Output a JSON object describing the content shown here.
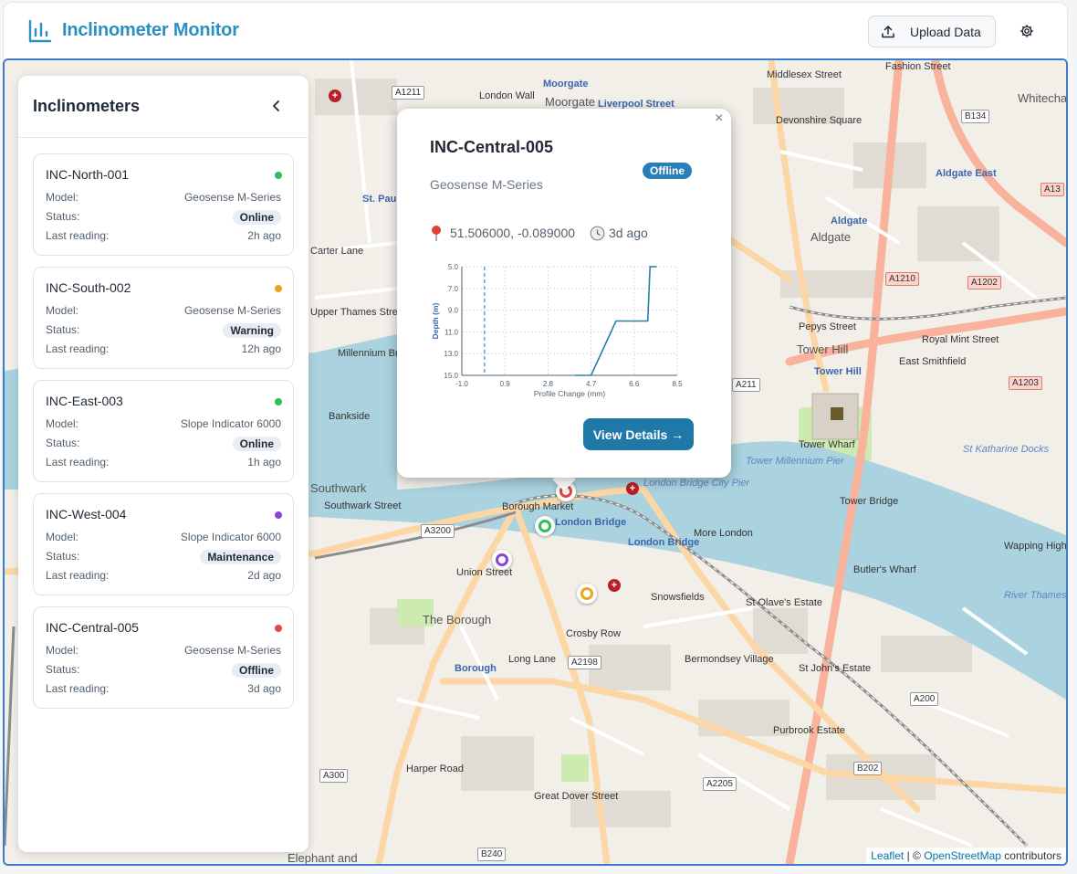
{
  "header": {
    "title": "Inclinometer Monitor",
    "upload_label": "Upload Data",
    "brand_color": "#2b8fc0"
  },
  "sidebar": {
    "title": "Inclinometers",
    "labels": {
      "model": "Model:",
      "status": "Status:",
      "last_reading": "Last reading:"
    },
    "items": [
      {
        "name": "INC-North-001",
        "model": "Geosense M-Series",
        "status": "Online",
        "last_reading": "2h ago",
        "dot_color": "#2ebd59"
      },
      {
        "name": "INC-South-002",
        "model": "Geosense M-Series",
        "status": "Warning",
        "last_reading": "12h ago",
        "dot_color": "#f0a020"
      },
      {
        "name": "INC-East-003",
        "model": "Slope Indicator 6000",
        "status": "Online",
        "last_reading": "1h ago",
        "dot_color": "#2ebd59"
      },
      {
        "name": "INC-West-004",
        "model": "Slope Indicator 6000",
        "status": "Maintenance",
        "last_reading": "2d ago",
        "dot_color": "#8a44d6"
      },
      {
        "name": "INC-Central-005",
        "model": "Geosense M-Series",
        "status": "Offline",
        "last_reading": "3d ago",
        "dot_color": "#e64545"
      }
    ]
  },
  "popup": {
    "title": "INC-Central-005",
    "status": "Offline",
    "model": "Geosense M-Series",
    "coords": "51.506000, -0.089000",
    "age": "3d ago",
    "button": "View Details →",
    "close": "×"
  },
  "chart_data": {
    "type": "line",
    "xlabel": "Profile Change (mm)",
    "ylabel": "Depth (m)",
    "x_ticks": [
      "-1.0",
      "0.9",
      "2.8",
      "4.7",
      "6.6",
      "8.5"
    ],
    "y_ticks": [
      "5.0",
      "7.0",
      "9.0",
      "11.0",
      "13.0",
      "15.0"
    ],
    "xlim": [
      -1.0,
      8.5
    ],
    "ylim": [
      5.0,
      15.0
    ],
    "y_inverted": true,
    "grid": true,
    "reference_x": 0,
    "series": [
      {
        "x": [
          4.0,
          4.7,
          5.8,
          7.2,
          7.3,
          7.6
        ],
        "y": [
          15.0,
          15.0,
          10.0,
          10.0,
          5.0,
          5.0
        ]
      }
    ]
  },
  "map": {
    "labels": [
      "Moorgate",
      "Moorgate",
      "Liverpool Street",
      "London Wall",
      "Middlesex Street",
      "Devonshire Square",
      "Whitechapel",
      "Aldgate East",
      "Aldgate",
      "Aldgate",
      "St. Paul's",
      "Carter Lane",
      "Upper Thames Street",
      "Millennium Bridge",
      "Bankside",
      "Southwark",
      "Southwark Street",
      "Borough Market",
      "London Bridge",
      "London Bridge",
      "London Bridge City Pier",
      "The Borough",
      "Borough",
      "Long Lane",
      "Bermondsey Village",
      "St Olave's Estate",
      "St John's Estate",
      "Tower Hill",
      "Tower Hill",
      "Tower Wharf",
      "Tower Millennium Pier",
      "Tower Bridge",
      "St Katharine Docks",
      "East Smithfield",
      "Royal Mint Street",
      "Pepys Street",
      "Butler's Wharf",
      "River Thames",
      "More London",
      "Purbrook Estate",
      "Great Dover Street",
      "Harper Road",
      "Elephant and",
      "Crosby Row",
      "Snowsfields",
      "Union Street",
      "Fashion Street",
      "Wapping High Street"
    ],
    "roads": [
      "A1211",
      "A1210",
      "A1202",
      "A1203",
      "A13",
      "B134",
      "A3200",
      "A2198",
      "A2205",
      "A200",
      "B202",
      "A300",
      "B240",
      "A211"
    ],
    "attribution": {
      "leaflet": "Leaflet",
      "sep": "| ©",
      "osm": "OpenStreetMap",
      "suffix": "contributors"
    },
    "markers": [
      {
        "name": "INC-North-001",
        "color": "#2ebd59"
      },
      {
        "name": "INC-South-002",
        "color": "#e8a718"
      },
      {
        "name": "INC-West-004",
        "color": "#8a44d6"
      },
      {
        "name": "INC-Central-005",
        "color": "#e64545"
      }
    ]
  }
}
